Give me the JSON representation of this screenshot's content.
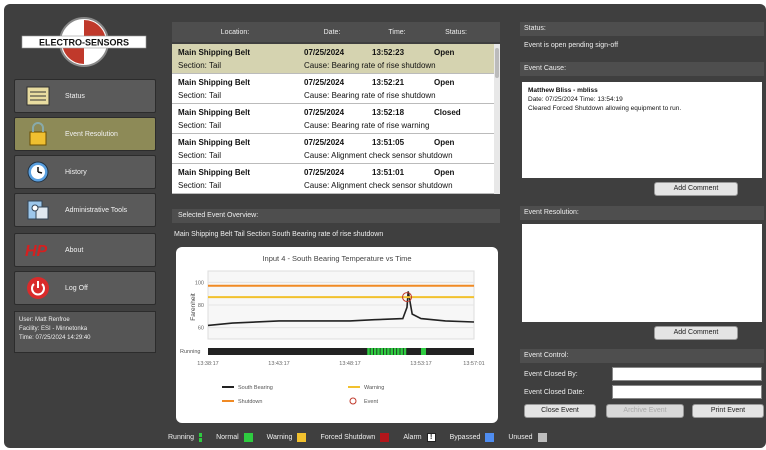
{
  "sidebar": {
    "logo_text": "ELECTRO-SENSORS",
    "items": [
      {
        "label": "Status",
        "icon": "status-panel-icon"
      },
      {
        "label": "Event Resolution",
        "icon": "lock-icon"
      },
      {
        "label": "History",
        "icon": "clock-icon"
      },
      {
        "label": "Administrative Tools",
        "icon": "admin-tools-icon"
      },
      {
        "label": "About",
        "icon": "hp-logo-icon"
      },
      {
        "label": "Log Off",
        "icon": "power-icon"
      }
    ],
    "user_line": "User: Matt Renfroe",
    "facility_line": "Facility: ESI - Minnetonka",
    "time_line": "Time: 07/25/2024 14:29:40"
  },
  "events": {
    "headers": [
      "Location:",
      "Date:",
      "Time:",
      "Status:"
    ],
    "rows": [
      {
        "location": "Main Shipping Belt",
        "section": "Section: Tail",
        "date": "07/25/2024",
        "time": "13:52:23",
        "status": "Open",
        "cause": "Cause: Bearing rate of rise shutdown"
      },
      {
        "location": "Main Shipping Belt",
        "section": "Section: Tail",
        "date": "07/25/2024",
        "time": "13:52:21",
        "status": "Open",
        "cause": "Cause: Bearing rate of rise shutdown"
      },
      {
        "location": "Main Shipping Belt",
        "section": "Section: Tail",
        "date": "07/25/2024",
        "time": "13:52:18",
        "status": "Closed",
        "cause": "Cause: Bearing rate of rise warning"
      },
      {
        "location": "Main Shipping Belt",
        "section": "Section: Tail",
        "date": "07/25/2024",
        "time": "13:51:05",
        "status": "Open",
        "cause": "Cause: Alignment check sensor shutdown"
      },
      {
        "location": "Main Shipping Belt",
        "section": "Section: Tail",
        "date": "07/25/2024",
        "time": "13:51:01",
        "status": "Open",
        "cause": "Cause: Alignment check sensor shutdown"
      }
    ]
  },
  "overview": {
    "header": "Selected Event Overview:",
    "text": "Main Shipping Belt Tail Section South Bearing rate of rise shutdown"
  },
  "chart_data": {
    "type": "line",
    "title": "Input 4 - South Bearing Temperature vs Time",
    "ylabel": "Farenheit",
    "xlabel": "",
    "y_ticks": [
      100,
      80,
      60
    ],
    "ylim": [
      50,
      110
    ],
    "x_ticks": [
      "13:38:17",
      "13:43:17",
      "13:48:17",
      "13:53:17",
      "13:57:01"
    ],
    "series": [
      {
        "name": "South Bearing",
        "color": "#222222",
        "x": [
          "13:38:17",
          "13:40:00",
          "13:43:17",
          "13:46:00",
          "13:48:17",
          "13:50:00",
          "13:52:00",
          "13:52:18",
          "13:52:23",
          "13:52:40",
          "13:53:17",
          "13:55:00",
          "13:57:01"
        ],
        "values": [
          62,
          64,
          66,
          66,
          66,
          67,
          68,
          78,
          92,
          72,
          68,
          66,
          65
        ]
      },
      {
        "name": "Warning",
        "color": "#f2c12e",
        "x": [
          "13:38:17",
          "13:57:01"
        ],
        "values": [
          87,
          87
        ]
      },
      {
        "name": "Shutdown",
        "color": "#f08a24",
        "x": [
          "13:38:17",
          "13:57:01"
        ],
        "values": [
          97,
          97
        ]
      }
    ],
    "event_marker": {
      "name": "Event",
      "x": "13:52:18",
      "value": 87,
      "color": "#c0392b"
    },
    "running_label": "Running",
    "legend": [
      "South Bearing",
      "Warning",
      "Shutdown",
      "Event"
    ],
    "legend_placement": "bottom"
  },
  "status": {
    "header": "Status:",
    "text": "Event is open pending sign-off"
  },
  "cause": {
    "header": "Event Cause:",
    "author": "Matthew Bliss - mbliss",
    "date_line": "Date: 07/25/2024 Time: 13:54:19",
    "note": "Cleared Forced Shutdown allowing equipment to run.",
    "add_comment": "Add Comment"
  },
  "resolution": {
    "header": "Event Resolution:",
    "add_comment": "Add Comment"
  },
  "control": {
    "header": "Event Control:",
    "closed_by_label": "Event Closed By:",
    "closed_date_label": "Event Closed Date:",
    "close_button": "Close Event",
    "archive_button": "Archive Event",
    "print_button": "Print Event"
  },
  "legend_bar": [
    {
      "label": "Running",
      "color": "#2ecc40"
    },
    {
      "label": "Normal",
      "color": "#2ecc40"
    },
    {
      "label": "Warning",
      "color": "#f2c12e"
    },
    {
      "label": "Forced Shutdown",
      "color": "#b3161b"
    },
    {
      "label": "Alarm",
      "color": "#444444"
    },
    {
      "label": "Bypassed",
      "color": "#4f8df0"
    },
    {
      "label": "Unused",
      "color": "#bdbdbd"
    }
  ]
}
